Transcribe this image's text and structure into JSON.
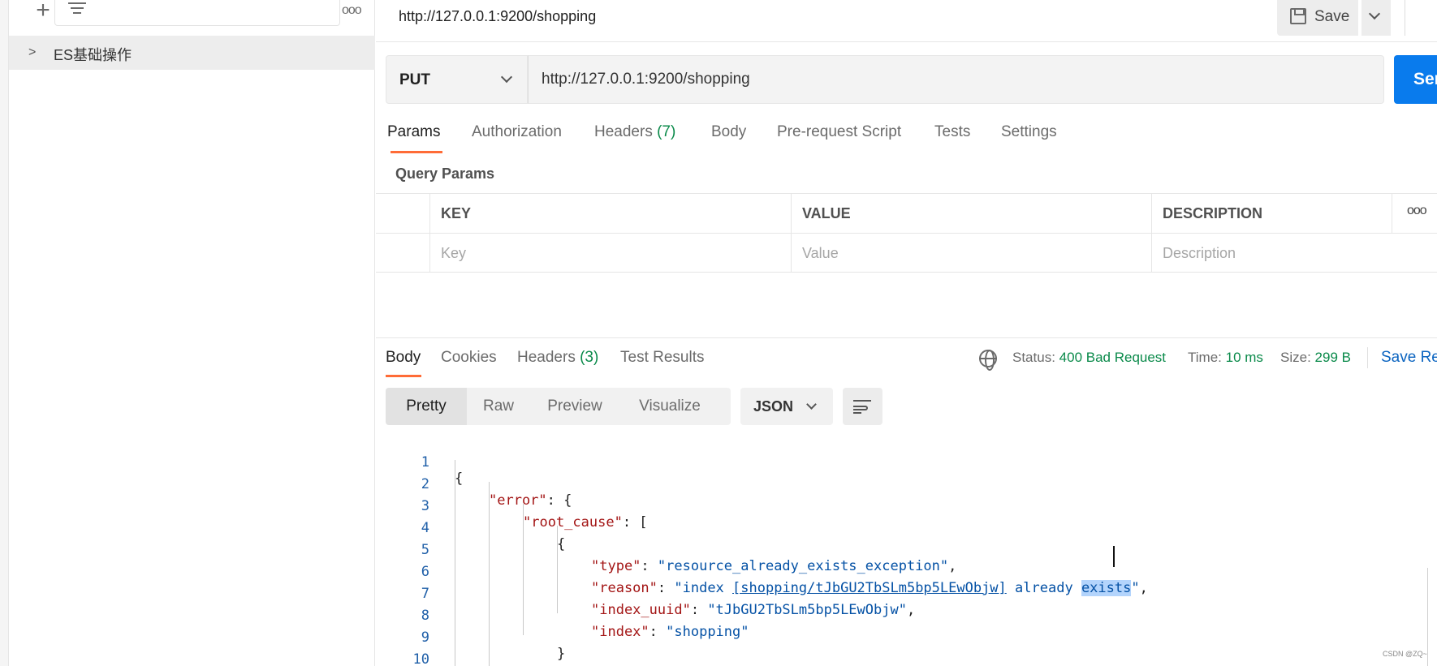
{
  "sidebar": {
    "collection_name": "ES基础操作"
  },
  "topbar": {
    "request_title": "http://127.0.0.1:9200/shopping",
    "save_label": "Save"
  },
  "request": {
    "method": "PUT",
    "url": "http://127.0.0.1:9200/shopping",
    "send_label": "Send"
  },
  "request_tabs": {
    "params": "Params",
    "authorization": "Authorization",
    "headers": "Headers",
    "headers_count": "(7)",
    "body": "Body",
    "prerequest": "Pre-request Script",
    "tests": "Tests",
    "settings": "Settings"
  },
  "query_params": {
    "title": "Query Params",
    "columns": [
      "KEY",
      "VALUE",
      "DESCRIPTION"
    ],
    "placeholders": [
      "Key",
      "Value",
      "Description"
    ]
  },
  "response_tabs": {
    "body": "Body",
    "cookies": "Cookies",
    "headers": "Headers",
    "headers_count": "(3)",
    "test_results": "Test Results"
  },
  "response_status": {
    "status_label": "Status:",
    "status_value": "400 Bad Request",
    "time_label": "Time:",
    "time_value": "10 ms",
    "size_label": "Size:",
    "size_value": "299 B",
    "save_response": "Save Response"
  },
  "view": {
    "modes": [
      "Pretty",
      "Raw",
      "Preview",
      "Visualize"
    ],
    "active_mode": "Pretty",
    "language": "JSON"
  },
  "code": {
    "line_numbers": [
      "1",
      "2",
      "3",
      "4",
      "5",
      "6",
      "7",
      "8",
      "9",
      "10"
    ],
    "keys": {
      "error": "\"error\"",
      "root_cause": "\"root_cause\"",
      "type": "\"type\"",
      "reason": "\"reason\"",
      "index_uuid": "\"index_uuid\"",
      "index": "\"index\""
    },
    "values": {
      "type": "\"resource_already_exists_exception\"",
      "reason_prefix": "\"index ",
      "reason_link": "[shopping/tJbGU2TbSLm5bp5LEwObjw]",
      "reason_mid": " already",
      "reason_selected": "exists",
      "reason_suffix": "\"",
      "index_uuid": "\"tJbGU2TbSLm5bp5LEwObjw\"",
      "index": "\"shopping\""
    }
  },
  "watermark": "CSDN @ZQ~"
}
